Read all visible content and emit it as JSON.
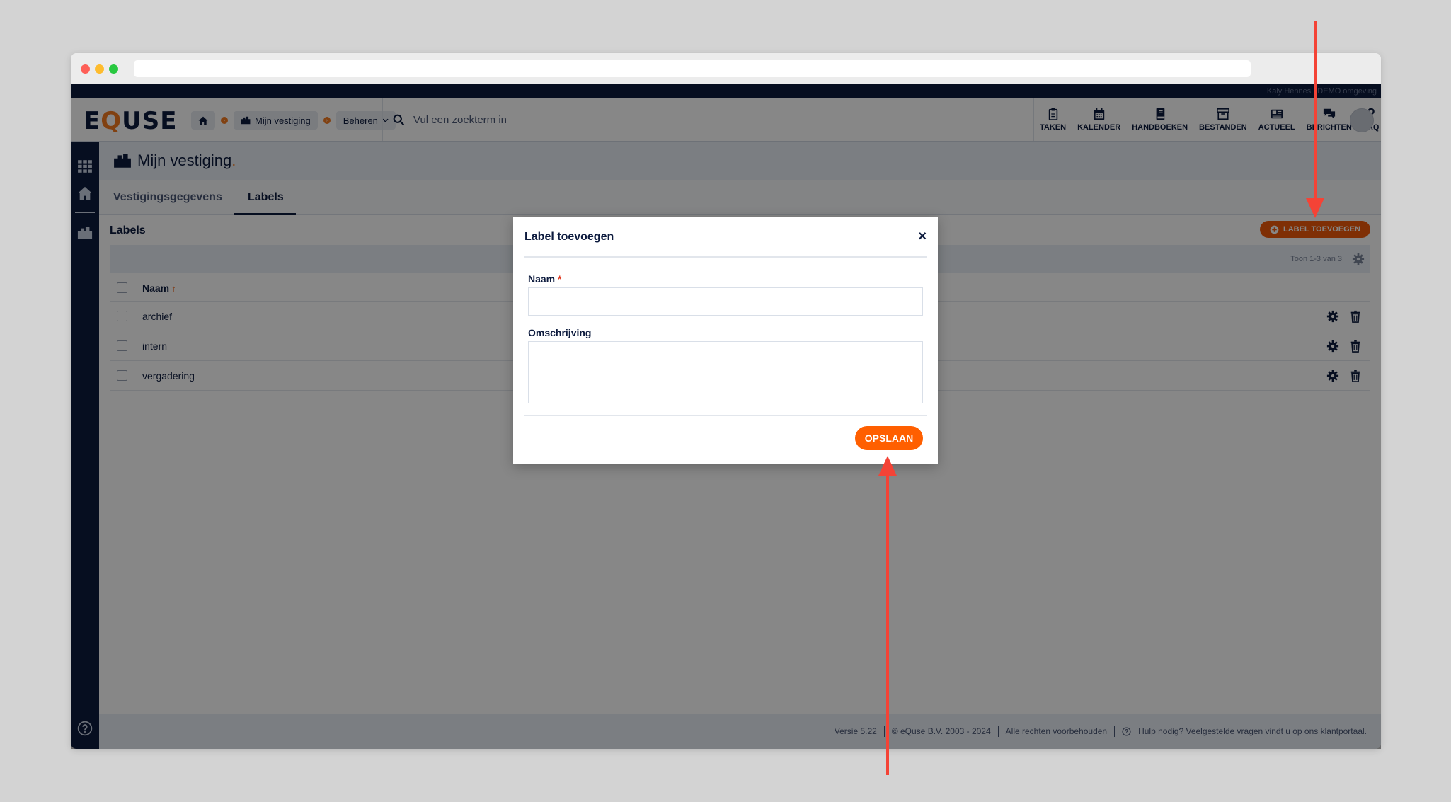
{
  "header": {
    "topstrip_text": "Kaly Hennes | DEMO omgeving",
    "logo": {
      "pre": "E",
      "q": "Q",
      "post": "USE"
    },
    "breadcrumb": {
      "location": "Mijn vestiging",
      "menu": "Beheren"
    },
    "search": {
      "placeholder": "Vul een zoekterm in"
    },
    "nav": [
      "TAKEN",
      "KALENDER",
      "HANDBOEKEN",
      "BESTANDEN",
      "ACTUEEL",
      "BERICHTEN",
      "FAQ"
    ]
  },
  "page": {
    "title": "Mijn vestiging",
    "title_dot": ".",
    "tabs": [
      "Vestigingsgegevens",
      "Labels"
    ],
    "active_tab": "Labels"
  },
  "labels_section": {
    "title": "Labels",
    "add_button": "LABEL TOEVOEGEN",
    "count": "Toon 1-3 van 3",
    "column": "Naam",
    "rows": [
      "archief",
      "intern",
      "vergadering"
    ]
  },
  "footer": {
    "version": "Versie 5.22",
    "copyright": "© eQuse B.V. 2003 - 2024",
    "rights": "Alle rechten voorbehouden",
    "help": "Hulp nodig? Veelgestelde vragen vindt u op ons klantportaal."
  },
  "modal": {
    "title": "Label toevoegen",
    "close": "×",
    "name_label": "Naam",
    "required_mark": "*",
    "name_value": "",
    "description_label": "Omschrijving",
    "description_value": "",
    "save_button": "OPSLAAN"
  },
  "colors": {
    "navy": "#0d1b3e",
    "accent": "#f05a0a",
    "annotation": "#f44336"
  }
}
